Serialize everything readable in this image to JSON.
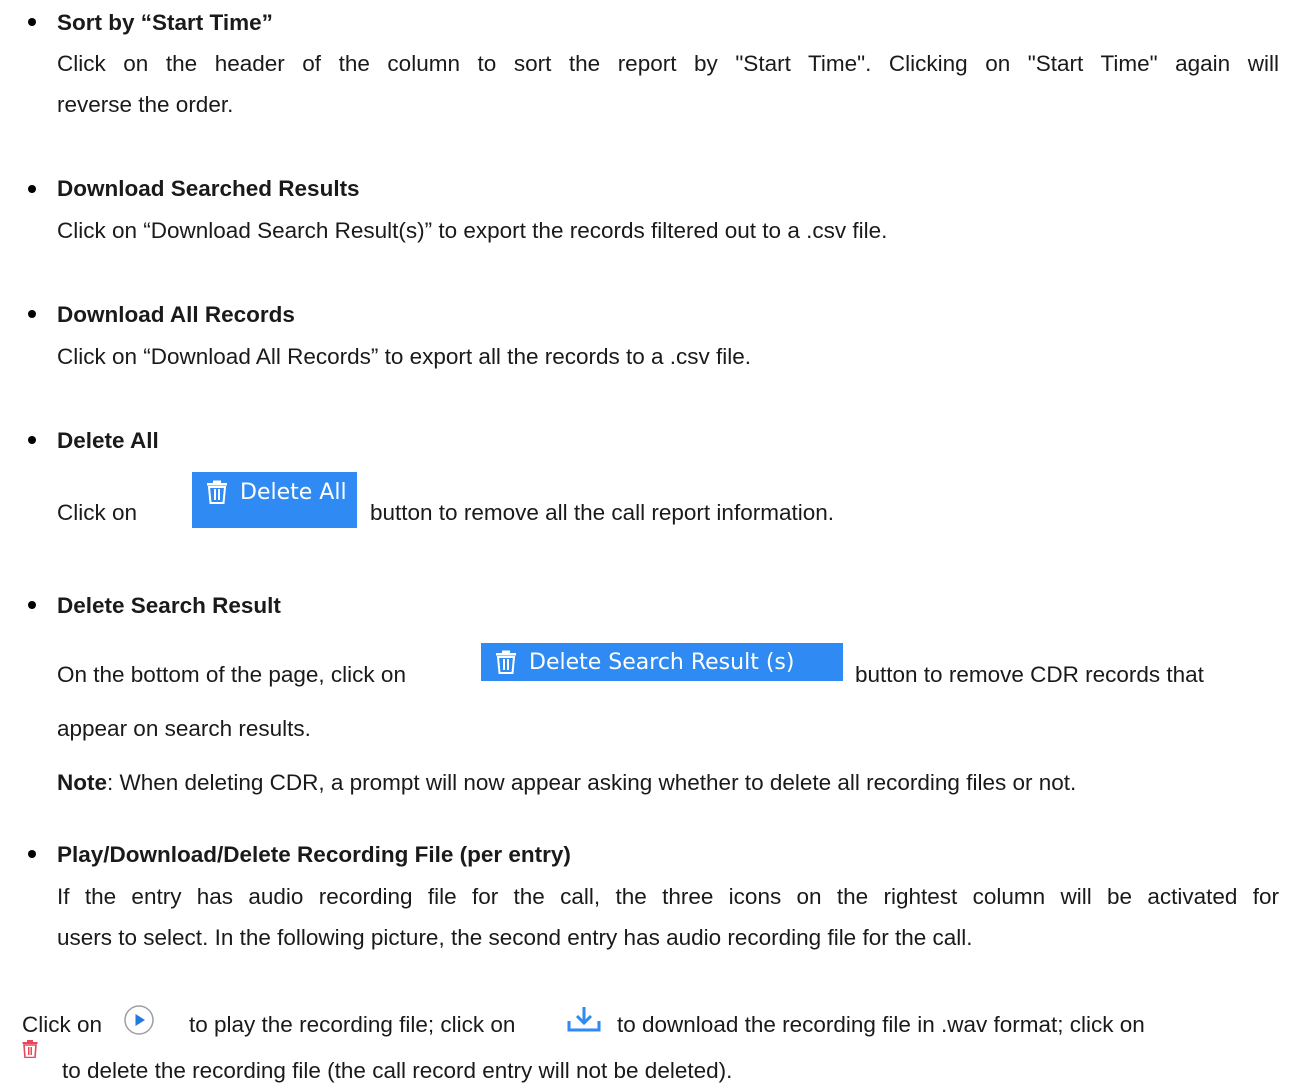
{
  "sections": {
    "sort": {
      "title": "Sort by “Start Time”",
      "line1": "Click on the header of the column to sort the report by \"Start Time\". Clicking on \"Start Time\" again will",
      "line2": "reverse the order."
    },
    "download_searched": {
      "title": "Download Searched Results",
      "line1": "Click on “Download Search Result(s)” to export the records filtered out to a .csv file."
    },
    "download_all": {
      "title": "Download All Records",
      "line1": "Click on “Download All Records” to export all the records to a .csv file."
    },
    "delete_all": {
      "title": "Delete All",
      "pre": "Click on",
      "button_label": "Delete All",
      "post": "button to remove all the call report information."
    },
    "delete_search": {
      "title": "Delete Search Result",
      "pre": "On the bottom of the page, click on",
      "button_label": "Delete Search Result (s)",
      "post": "button to remove CDR records that",
      "line2": "appear on search results.",
      "note_label": "Note",
      "note_text": ": When deleting CDR, a prompt will now appear asking whether to delete all recording files or not."
    },
    "recording": {
      "title": "Play/Download/Delete Recording File (per entry)",
      "line1": "If the entry has audio recording file for the call, the three icons on the rightest column will be activated for",
      "line2": "users to select. In the following picture, the second entry has audio recording file for the call."
    }
  },
  "footer": {
    "part1": "Click on",
    "part2": "to play the recording file; click on",
    "part3": "to download the recording file in .wav format; click on",
    "part4": "to delete the recording file (the call record entry will not be deleted)."
  },
  "icons": {
    "trash": "trash-icon",
    "play": "play-circle-icon",
    "download": "download-icon",
    "delete_red": "trash-red-icon"
  },
  "colors": {
    "button_bg": "#2f8bf3",
    "play_icon": "#1f7ae0",
    "download_icon": "#2f8bf3",
    "delete_icon": "#e8475b"
  }
}
